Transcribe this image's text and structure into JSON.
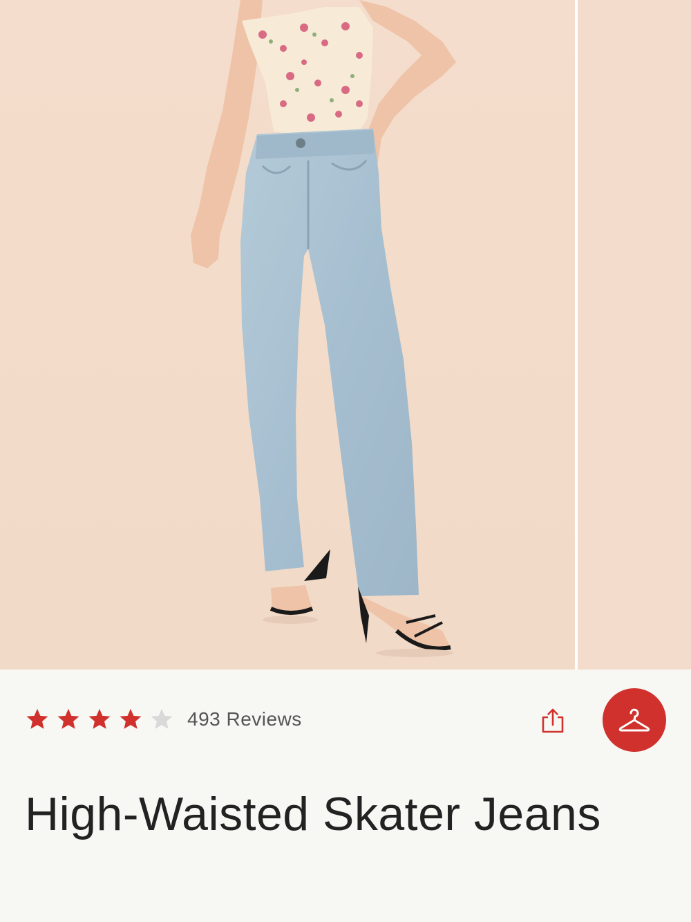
{
  "product": {
    "title": "High-Waisted Skater Jeans",
    "rating_value": 4,
    "rating_max": 5,
    "review_count_label": "493 Reviews"
  },
  "icons": {
    "share": "share-icon",
    "hanger": "hanger-icon",
    "star_filled": "star-filled-icon",
    "star_empty": "star-empty-icon"
  },
  "colors": {
    "accent": "#d0312d",
    "star_filled": "#d0312d",
    "star_empty": "#d9d9d9",
    "background": "#f7f8f3",
    "photo_backdrop": "#f3dccb"
  }
}
